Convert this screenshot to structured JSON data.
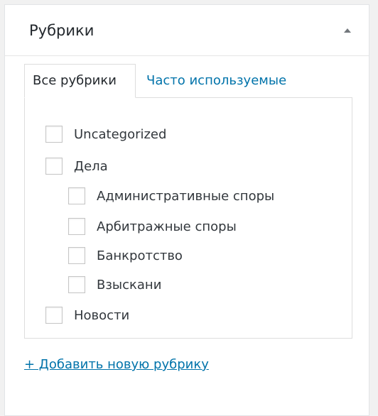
{
  "panel": {
    "title": "Рубрики",
    "collapse_icon": "triangle-up-icon"
  },
  "tabs": [
    {
      "label": "Все рубрики",
      "active": true
    },
    {
      "label": "Часто используемые",
      "active": false
    }
  ],
  "categories": [
    {
      "label": "Uncategorized",
      "level": 0,
      "checked": false
    },
    {
      "label": "Дела",
      "level": 0,
      "checked": false
    },
    {
      "label": "Административные споры",
      "level": 1,
      "checked": false
    },
    {
      "label": "Арбитражные споры",
      "level": 1,
      "checked": false
    },
    {
      "label": "Банкротство",
      "level": 1,
      "checked": false
    },
    {
      "label": "Взыскани",
      "level": 1,
      "checked": false
    },
    {
      "label": "Новости",
      "level": 0,
      "checked": false
    }
  ],
  "add_link": "+ Добавить новую рубрику",
  "colors": {
    "link": "#0073aa",
    "border": "#dddddd",
    "text": "#23282d"
  }
}
